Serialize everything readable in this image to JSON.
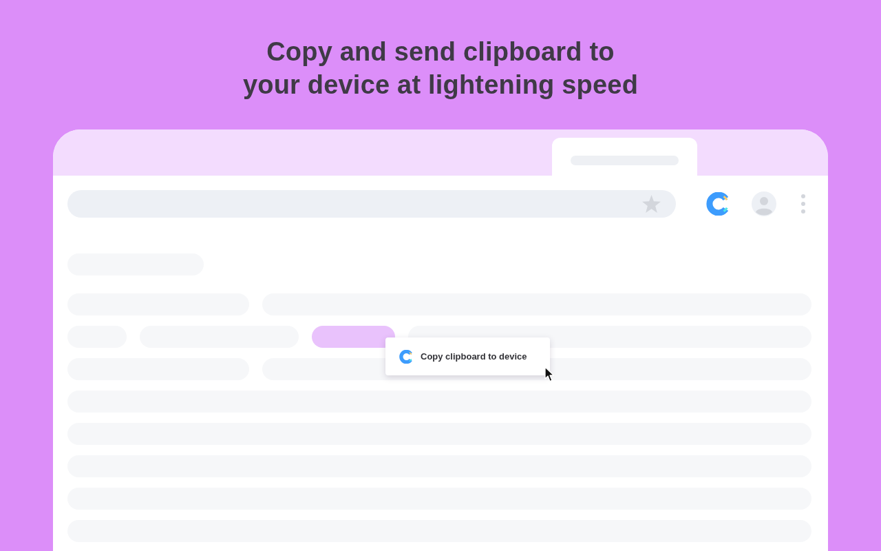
{
  "headline": "Copy and send clipboard to\nyour device at lightening speed",
  "popup": {
    "label": "Copy clipboard to device"
  }
}
